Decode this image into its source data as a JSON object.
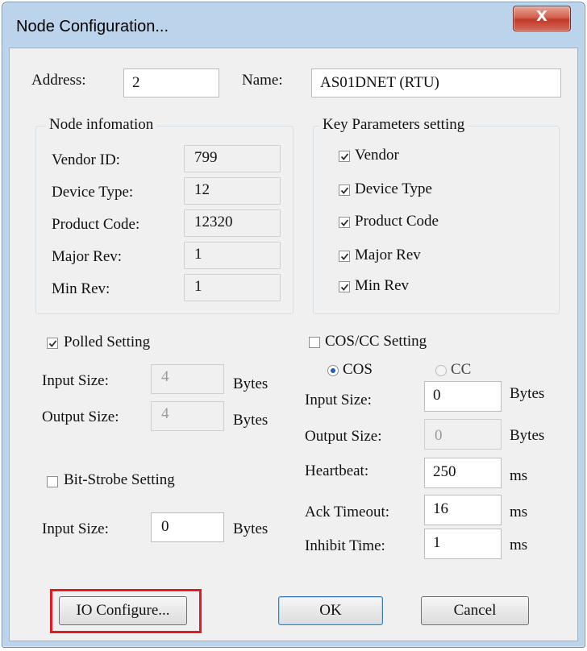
{
  "window": {
    "title": "Node Configuration...",
    "close_glyph": "X"
  },
  "address": {
    "label": "Address:",
    "value": "2"
  },
  "name": {
    "label": "Name:",
    "value": "AS01DNET (RTU)"
  },
  "node_info": {
    "title": "Node infomation",
    "rows": [
      {
        "label": "Vendor ID:",
        "value": "799"
      },
      {
        "label": "Device Type:",
        "value": "12"
      },
      {
        "label": "Product Code:",
        "value": "12320"
      },
      {
        "label": "Major Rev:",
        "value": "1"
      },
      {
        "label": "Min Rev:",
        "value": "1"
      }
    ]
  },
  "key_params": {
    "title": "Key Parameters setting",
    "items": [
      {
        "label": "Vendor",
        "checked": true
      },
      {
        "label": "Device Type",
        "checked": true
      },
      {
        "label": "Product Code",
        "checked": true
      },
      {
        "label": "Major Rev",
        "checked": true
      },
      {
        "label": "Min Rev",
        "checked": true
      }
    ]
  },
  "polled": {
    "label": "Polled Setting",
    "checked": true,
    "input_label": "Input Size:",
    "input_value": "4",
    "output_label": "Output Size:",
    "output_value": "4",
    "unit": "Bytes"
  },
  "bitstrobe": {
    "label": "Bit-Strobe Setting",
    "checked": false,
    "input_label": "Input Size:",
    "input_value": "0",
    "unit": "Bytes"
  },
  "coscc": {
    "label": "COS/CC Setting",
    "checked": false,
    "radio_cos": "COS",
    "radio_cc": "CC",
    "selected": "COS",
    "input_label": "Input Size:",
    "input_value": "0",
    "output_label": "Output Size:",
    "output_value": "0",
    "heartbeat_label": "Heartbeat:",
    "heartbeat_value": "250",
    "ack_label": "Ack Timeout:",
    "ack_value": "16",
    "inhibit_label": "Inhibit Time:",
    "inhibit_value": "1",
    "bytes_unit": "Bytes",
    "ms_unit": "ms"
  },
  "buttons": {
    "io_configure": "IO Configure...",
    "ok": "OK",
    "cancel": "Cancel"
  },
  "colors": {
    "highlight": "#e31b23",
    "close_button": "#c0392b",
    "title_bar": "#bcd3ec"
  }
}
